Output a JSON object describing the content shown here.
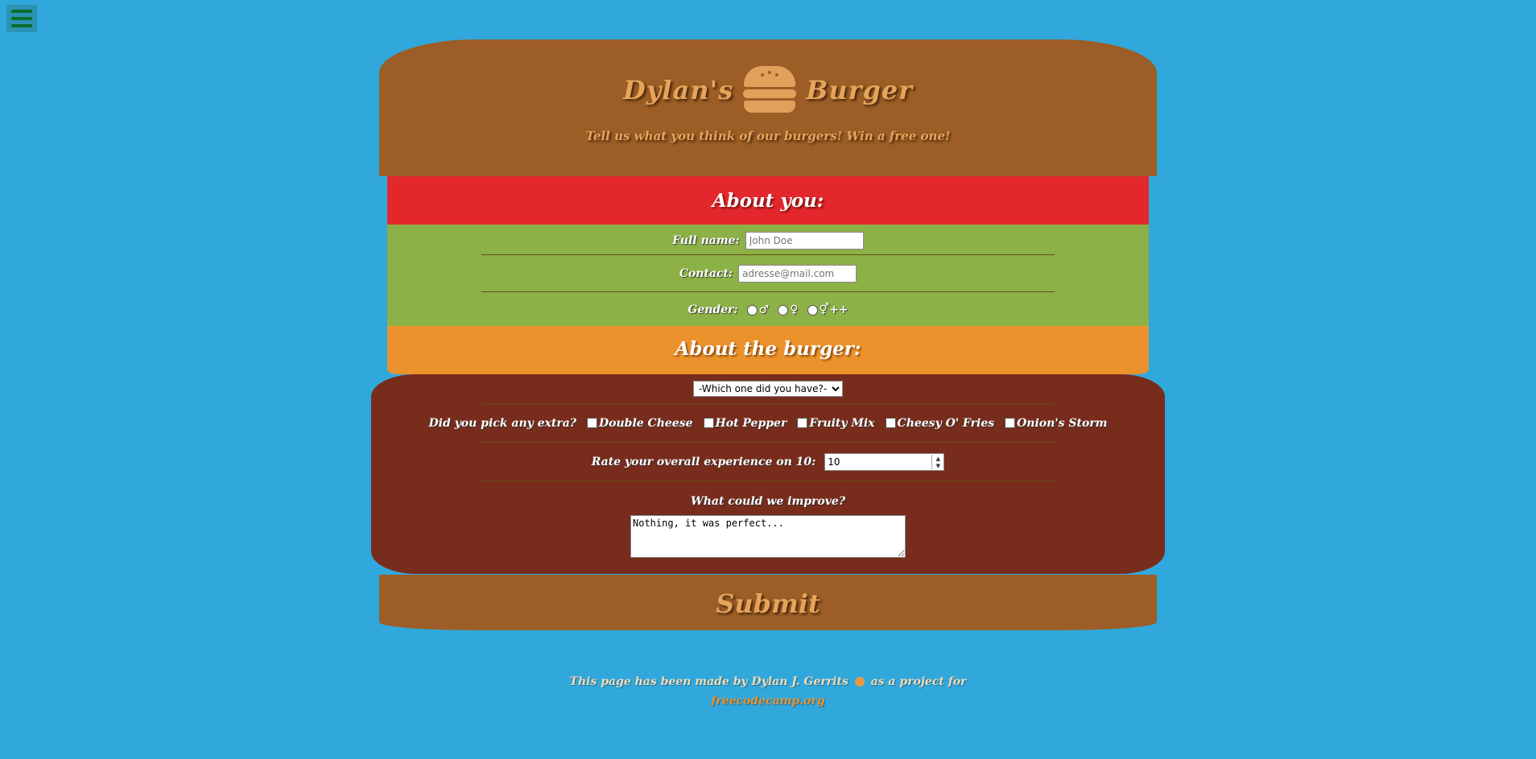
{
  "header": {
    "title_left": "Dylan's",
    "title_right": "Burger",
    "subtitle": "Tell us what you think of our burgers! Win a free one!"
  },
  "about_you": {
    "heading": "About you:",
    "fullname_label": "Full name:",
    "fullname_placeholder": "John Doe",
    "contact_label": "Contact:",
    "contact_placeholder": "adresse@mail.com",
    "gender_label": "Gender:",
    "gender_options": [
      "♂",
      "♀",
      "⚥++"
    ]
  },
  "about_burger": {
    "heading": "About the burger:",
    "select_value": "-Which one did you have?-",
    "extra_label": "Did you pick any extra?",
    "extras": [
      "Double Cheese",
      "Hot Pepper",
      "Fruity Mix",
      "Cheesy O' Fries",
      "Onion's Storm"
    ],
    "rate_label": "Rate your overall experience on 10:",
    "rate_value": "10",
    "improve_label": "What could we improve?",
    "improve_value": "Nothing, it was perfect..."
  },
  "submit_label": "Submit",
  "footer": {
    "line1_prefix": "This page has been made by Dylan J. Gerrits",
    "line1_suffix": "as a project for",
    "link": "freecodecamp.org"
  },
  "colors": {
    "background": "#31a8dc",
    "bun": "#9c5e26",
    "tomato": "#e3282d",
    "lettuce": "#8cb146",
    "cheese": "#ec922c",
    "patty": "#782c1b"
  },
  "icons": [
    "hamburger-menu-icon",
    "burger-icon",
    "github-icon"
  ]
}
